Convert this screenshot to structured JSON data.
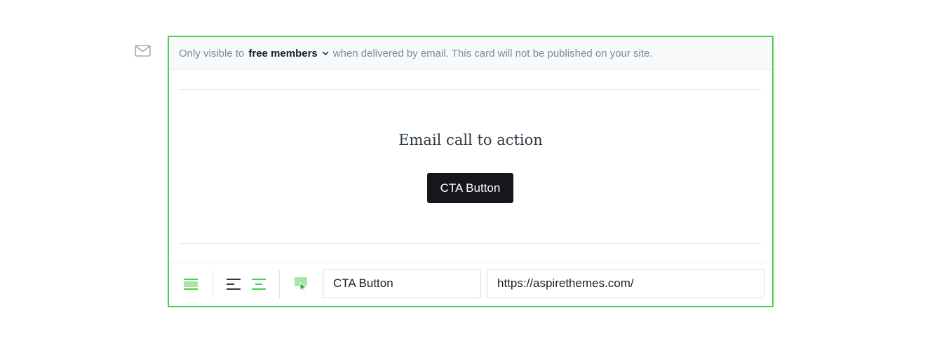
{
  "gutter": {
    "icon": "envelope-icon"
  },
  "card": {
    "visibility": {
      "prefix": "Only visible to",
      "segment": "free members",
      "suffix": "when delivered by email. This card will not be published on your site."
    },
    "heading": "Email call to action",
    "button_label": "CTA Button",
    "toolbar": {
      "layout_icon": "full-width-layout-icon",
      "align_left_icon": "align-left-icon",
      "align_center_icon": "align-center-icon",
      "image_icon": "image-cursor-icon",
      "button_text_value": "CTA Button",
      "button_url_value": "https://aspirethemes.com/"
    }
  },
  "colors": {
    "accent": "#4ccf4c",
    "button_bg": "#15171a",
    "muted_text": "#7c8b9a"
  }
}
